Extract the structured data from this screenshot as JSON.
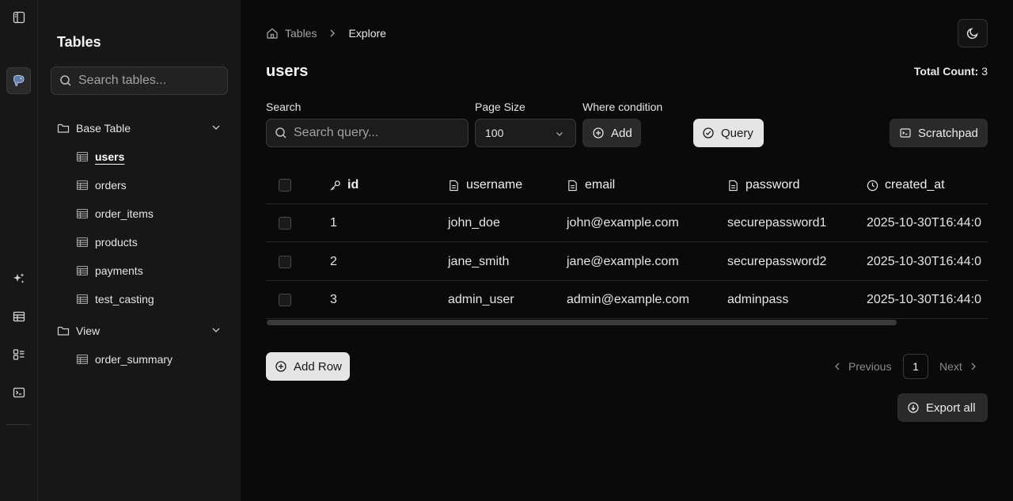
{
  "sidebar": {
    "title": "Tables",
    "search_placeholder": "Search tables...",
    "groups": [
      {
        "label": "Base Table",
        "items": [
          "users",
          "orders",
          "order_items",
          "products",
          "payments",
          "test_casting"
        ]
      },
      {
        "label": "View",
        "items": [
          "order_summary"
        ]
      }
    ],
    "active_item": "users"
  },
  "breadcrumb": {
    "home": "Tables",
    "current": "Explore"
  },
  "page": {
    "title": "users",
    "total_label": "Total Count:",
    "total_value": "3"
  },
  "controls": {
    "search_label": "Search",
    "search_placeholder": "Search query...",
    "page_size_label": "Page Size",
    "page_size_value": "100",
    "where_label": "Where condition",
    "add_label": "Add",
    "query_label": "Query",
    "scratchpad_label": "Scratchpad"
  },
  "table": {
    "columns": [
      "id",
      "username",
      "email",
      "password",
      "created_at"
    ],
    "rows": [
      [
        "1",
        "john_doe",
        "john@example.com",
        "securepassword1",
        "2025-10-30T16:44:0"
      ],
      [
        "2",
        "jane_smith",
        "jane@example.com",
        "securepassword2",
        "2025-10-30T16:44:0"
      ],
      [
        "3",
        "admin_user",
        "admin@example.com",
        "adminpass",
        "2025-10-30T16:44:0"
      ]
    ]
  },
  "footer": {
    "add_row_label": "Add Row",
    "previous_label": "Previous",
    "page_number": "1",
    "next_label": "Next",
    "export_label": "Export all"
  },
  "icons": {
    "column_id": "key-icon",
    "column_text": "file-text-icon",
    "column_time": "clock-icon"
  }
}
